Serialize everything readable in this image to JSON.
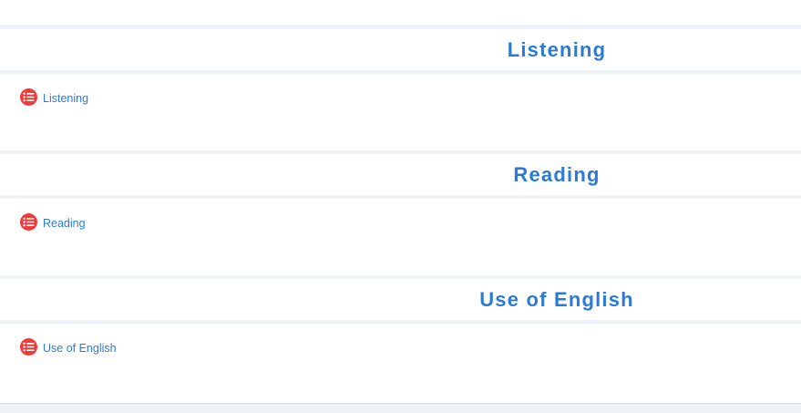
{
  "sections": [
    {
      "title": "Listening",
      "activity": {
        "label": "Listening",
        "icon": "list-icon"
      }
    },
    {
      "title": "Reading",
      "activity": {
        "label": "Reading",
        "icon": "list-icon"
      }
    },
    {
      "title": "Use of English",
      "activity": {
        "label": "Use of English",
        "icon": "list-icon"
      }
    }
  ],
  "colors": {
    "accent": "#2b7bd6",
    "icon_badge": "#f03b3b",
    "background": "#eef3f7",
    "panel": "#ffffff"
  }
}
